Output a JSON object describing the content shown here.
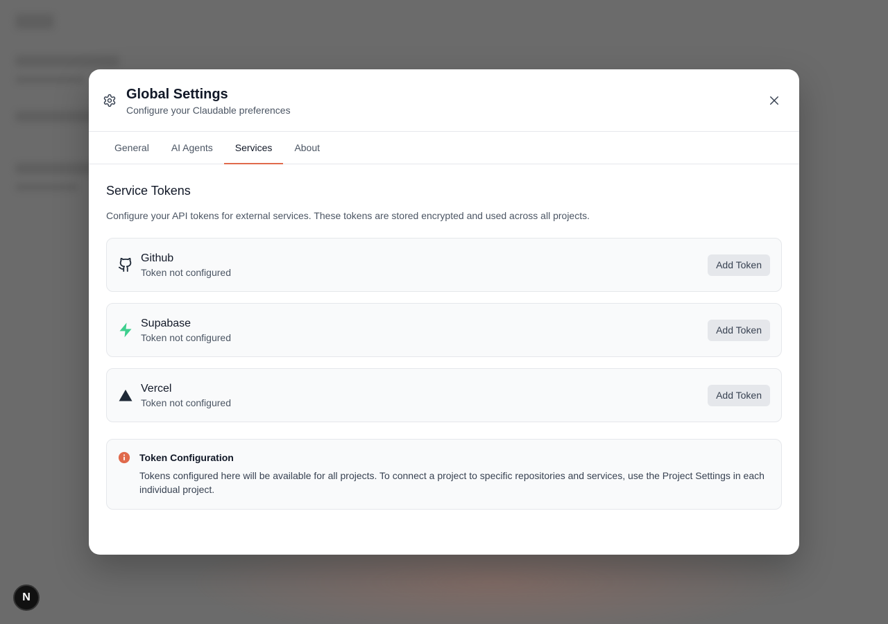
{
  "modal": {
    "title": "Global Settings",
    "subtitle": "Configure your Claudable preferences"
  },
  "tabs": [
    {
      "label": "General",
      "active": false
    },
    {
      "label": "AI Agents",
      "active": false
    },
    {
      "label": "Services",
      "active": true
    },
    {
      "label": "About",
      "active": false
    }
  ],
  "services_section": {
    "title": "Service Tokens",
    "description": "Configure your API tokens for external services. These tokens are stored encrypted and used across all projects.",
    "items": [
      {
        "name": "Github",
        "status": "Token not configured",
        "button": "Add Token",
        "icon": "github-icon"
      },
      {
        "name": "Supabase",
        "status": "Token not configured",
        "button": "Add Token",
        "icon": "supabase-icon"
      },
      {
        "name": "Vercel",
        "status": "Token not configured",
        "button": "Add Token",
        "icon": "vercel-icon"
      }
    ]
  },
  "info": {
    "title": "Token Configuration",
    "body": "Tokens configured here will be available for all projects. To connect a project to specific repositories and services, use the Project Settings in each individual project."
  },
  "dev_badge": {
    "label": "N"
  },
  "colors": {
    "accent": "#e06a4c",
    "supabase": "#3ecf8e",
    "backdrop": "#6b6b6b"
  }
}
